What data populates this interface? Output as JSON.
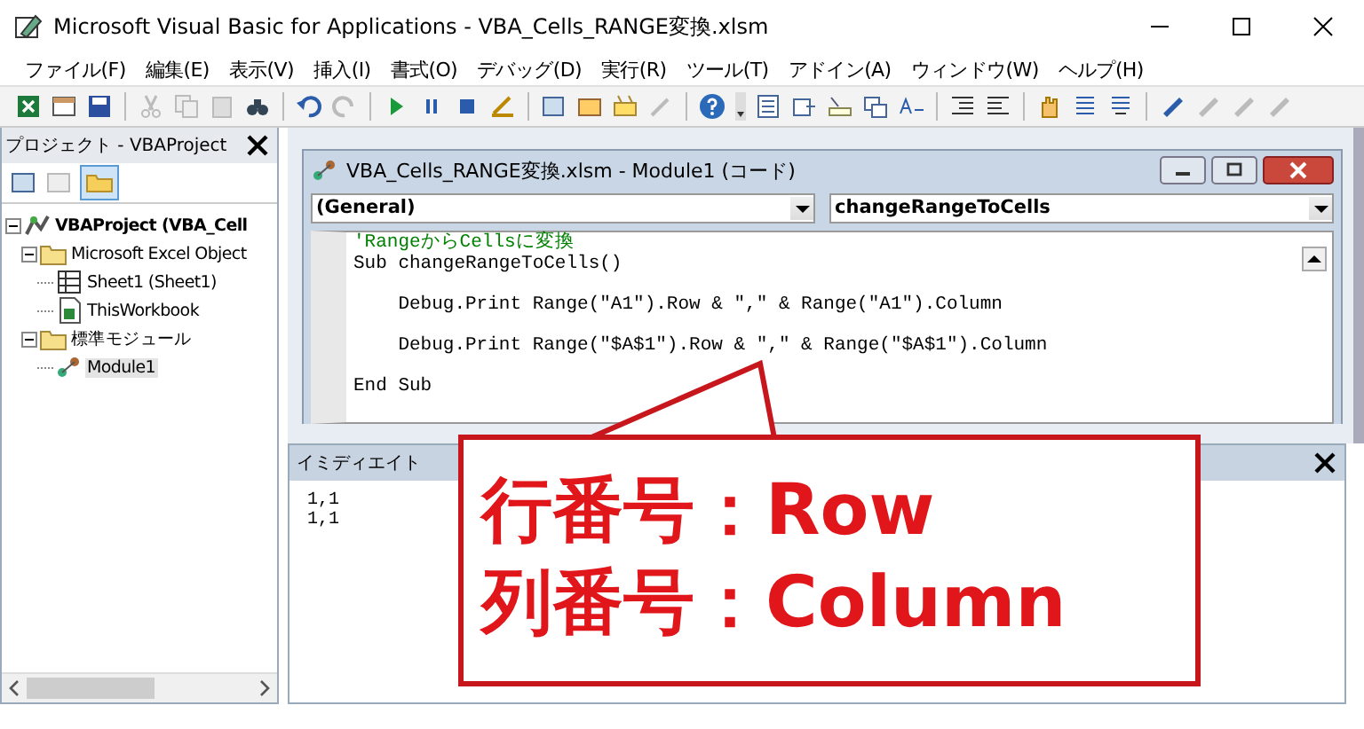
{
  "window": {
    "title": "Microsoft Visual Basic for Applications - VBA_Cells_RANGE変換.xlsm"
  },
  "menu": [
    "ファイル(F)",
    "編集(E)",
    "表示(V)",
    "挿入(I)",
    "書式(O)",
    "デバッグ(D)",
    "実行(R)",
    "ツール(T)",
    "アドイン(A)",
    "ウィンドウ(W)",
    "ヘルプ(H)"
  ],
  "project_pane": {
    "title": "プロジェクト - VBAProject",
    "tree": [
      {
        "label": "VBAProject (VBA_Cell",
        "kind": "project",
        "bold": true,
        "expanded": true,
        "selected": false,
        "children": [
          {
            "label": "Microsoft Excel Object",
            "kind": "folder",
            "bold": false,
            "expanded": true,
            "selected": false,
            "children": [
              {
                "label": "Sheet1 (Sheet1)",
                "kind": "sheet",
                "bold": false,
                "selected": false
              },
              {
                "label": "ThisWorkbook",
                "kind": "workbook",
                "bold": false,
                "selected": false
              }
            ]
          },
          {
            "label": "標準モジュール",
            "kind": "folder",
            "bold": false,
            "expanded": true,
            "selected": false,
            "children": [
              {
                "label": "Module1",
                "kind": "module",
                "bold": false,
                "selected": true
              }
            ]
          }
        ]
      }
    ]
  },
  "code_window": {
    "title": "VBA_Cells_RANGE変換.xlsm - Module1 (コード)",
    "object_dropdown": "(General)",
    "procedure_dropdown": "changeRangeToCells",
    "lines": [
      {
        "kind": "comment",
        "text": "'RangeからCellsに変換"
      },
      {
        "kind": "code",
        "text": "Sub changeRangeToCells()"
      },
      {
        "kind": "blank"
      },
      {
        "kind": "code",
        "text": "    Debug.Print Range(\"A1\").Row & \",\" & Range(\"A1\").Column"
      },
      {
        "kind": "blank"
      },
      {
        "kind": "code",
        "text": "    Debug.Print Range(\"$A$1\").Row & \",\" & Range(\"$A$1\").Column"
      },
      {
        "kind": "blank"
      },
      {
        "kind": "code",
        "text": "End Sub"
      }
    ]
  },
  "immediate": {
    "title": "イミディエイト",
    "lines": [
      "1,1",
      "1,1"
    ]
  },
  "callout": {
    "lines": [
      "行番号：Row",
      "列番号：Column"
    ]
  }
}
